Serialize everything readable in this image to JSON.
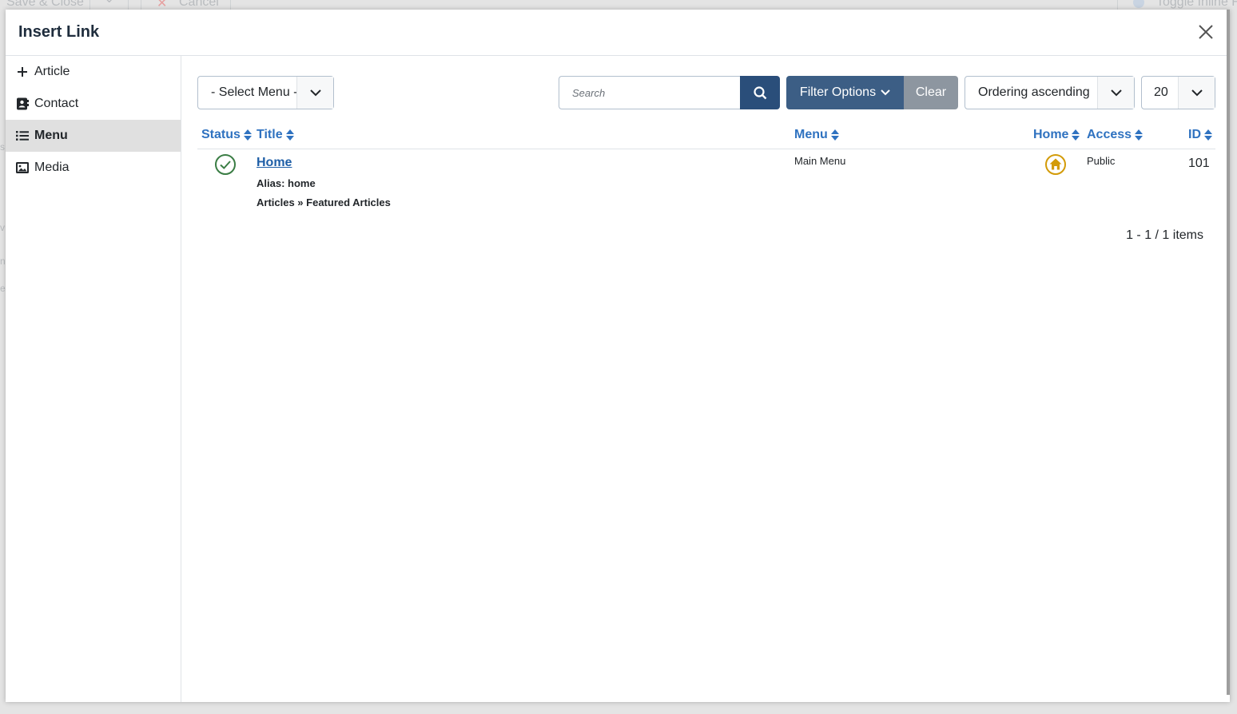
{
  "background": {
    "toolbar": {
      "save_close": "Save & Close",
      "cancel": "Cancel",
      "toggle": "Toggle Inline Fields"
    }
  },
  "modal": {
    "title": "Insert Link",
    "close_icon": "close-icon"
  },
  "sidebar": {
    "items": [
      {
        "label": "Article",
        "icon": "plus-icon"
      },
      {
        "label": "Contact",
        "icon": "contact-card-icon"
      },
      {
        "label": "Menu",
        "icon": "list-icon",
        "active": true
      },
      {
        "label": "Media",
        "icon": "image-icon"
      }
    ]
  },
  "filters": {
    "menu_select": "- Select Menu -",
    "search_placeholder": "Search",
    "filter_options": "Filter Options",
    "clear": "Clear",
    "ordering": "Ordering ascending",
    "limit": "20"
  },
  "table": {
    "columns": {
      "status": "Status",
      "title": "Title",
      "menu": "Menu",
      "home": "Home",
      "access": "Access",
      "id": "ID"
    },
    "rows": [
      {
        "status": "published",
        "title": "Home",
        "alias": "Alias: home",
        "path": "Articles » Featured Articles",
        "menu": "Main Menu",
        "home": "home-icon",
        "access": "Public",
        "id": "101"
      }
    ]
  },
  "pagination": {
    "summary": "1 - 1 / 1 items"
  },
  "colors": {
    "primary": "#2a4e7a",
    "link": "#2f72c0",
    "success": "#3a7d44",
    "home": "#d39b08"
  }
}
